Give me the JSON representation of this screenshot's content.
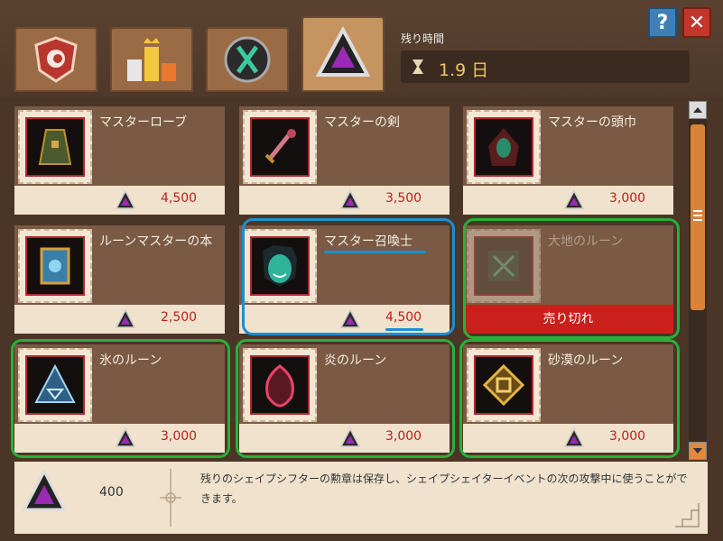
{
  "header": {
    "tabs": [
      {
        "icon": "shield-icon"
      },
      {
        "icon": "leaderboard-icon"
      },
      {
        "icon": "rune-emblem-icon"
      },
      {
        "icon": "triangle-gem-icon",
        "active": true
      }
    ],
    "timer_label": "残り時間",
    "timer_value": "1.9 日",
    "help_label": "?",
    "close_label": "✕"
  },
  "shop": {
    "items": [
      {
        "name": "マスターローブ",
        "price": "4,500",
        "icon": "robe-icon"
      },
      {
        "name": "マスターの剣",
        "price": "3,500",
        "icon": "sword-icon"
      },
      {
        "name": "マスターの頭巾",
        "price": "3,000",
        "icon": "hood-icon"
      },
      {
        "name": "ルーンマスターの本",
        "price": "2,500",
        "icon": "book-icon"
      },
      {
        "name": "マスター召喚士",
        "price": "4,500",
        "icon": "summoner-portrait-icon"
      },
      {
        "name": "大地のルーン",
        "price": "",
        "icon": "earth-rune-icon",
        "sold_out": "売り切れ"
      },
      {
        "name": "氷のルーン",
        "price": "3,000",
        "icon": "ice-rune-icon"
      },
      {
        "name": "炎のルーン",
        "price": "3,000",
        "icon": "fire-rune-icon"
      },
      {
        "name": "砂漠のルーン",
        "price": "3,000",
        "icon": "desert-rune-icon"
      }
    ]
  },
  "footer": {
    "count": "400",
    "description": "残りのシェイプシフターの勲章は保存し、シェイプシェイターイベントの次の攻撃中に使うことができます。"
  },
  "colors": {
    "accent": "#c0201c",
    "highlight_blue": "#1c8ed2",
    "highlight_green": "#28b03a",
    "timer": "#f1c46a"
  }
}
